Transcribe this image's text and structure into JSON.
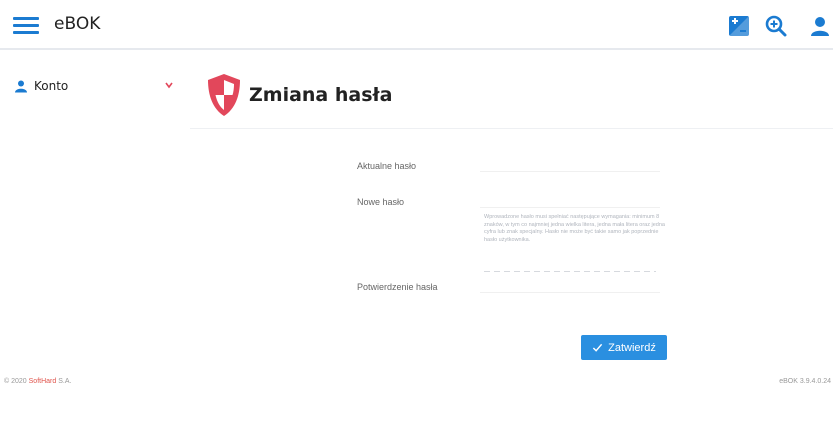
{
  "app": {
    "title": "eBOK"
  },
  "header": {
    "icons": [
      "hamburger-menu-icon",
      "contrast-icon",
      "zoom-in-icon",
      "user-icon"
    ]
  },
  "sidebar": {
    "items": [
      {
        "label": "Konto",
        "icon": "user-icon",
        "expand_icon": "chevron-down-icon"
      }
    ]
  },
  "page": {
    "title": "Zmiana hasła",
    "icon": "shield-icon"
  },
  "form": {
    "current_password": {
      "label": "Aktualne hasło",
      "value": ""
    },
    "new_password": {
      "label": "Nowe hasło",
      "value": "",
      "hint": "Wprowadzone hasło musi spełniać następujące wymagania: minimum 8 znaków, w tym co najmniej jedna wielka litera, jedna mała litera oraz jedna cyfra lub znak specjalny. Hasło nie może być takie samo jak poprzednie hasło użytkownika."
    },
    "confirm_password": {
      "label": "Potwierdzenie hasła",
      "value": ""
    },
    "submit_label": "Zatwierdź"
  },
  "footer": {
    "copyright_prefix": "© 2020",
    "brand": "SoftHard",
    "brand_suffix": "S.A.",
    "version": "eBOK 3.9.4.0.24"
  },
  "colors": {
    "primary": "#1b7bd1",
    "button": "#2a8fe0",
    "shield": "#e2475b",
    "brand": "#e0554d"
  }
}
